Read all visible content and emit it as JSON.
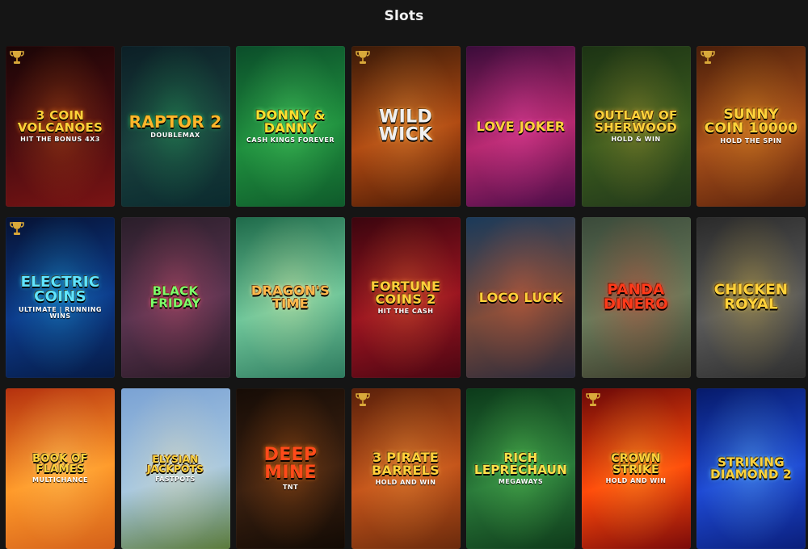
{
  "page": {
    "title": "Slots"
  },
  "games": [
    {
      "logo": "3 COIN VOLCANOES",
      "sub": "HIT the BONUS 4x3",
      "trophy": true,
      "bg": [
        "#1a0506",
        "#4a0c10",
        "#7a1414"
      ],
      "glow": "#ff7a1a",
      "fg": "#ffd23a",
      "size": 15
    },
    {
      "logo": "RAPTOR 2",
      "sub": "DOUBLEMAX",
      "trophy": false,
      "bg": [
        "#0c1f26",
        "#193f3d",
        "#0b2a2e"
      ],
      "glow": "#2ecf6a",
      "fg": "#ffb52a",
      "size": 20
    },
    {
      "logo": "Donny & Danny",
      "sub": "CASH KINGS FOREVER",
      "trophy": false,
      "bg": [
        "#0b4d2a",
        "#1f8f3e",
        "#0f5a2b"
      ],
      "glow": "#6bff7a",
      "fg": "#ffdf2e",
      "size": 16
    },
    {
      "logo": "WILD WICK",
      "sub": "",
      "trophy": true,
      "bg": [
        "#3a1a08",
        "#b04a12",
        "#4a1a06"
      ],
      "glow": "#ffb04a",
      "fg": "#f0f0f0",
      "size": 22
    },
    {
      "logo": "LOVE JOKER",
      "sub": "",
      "trophy": false,
      "bg": [
        "#3a0c3a",
        "#b4286e",
        "#4a0d48"
      ],
      "glow": "#ff4fb4",
      "fg": "#ffd23a",
      "size": 16
    },
    {
      "logo": "OUTLAW OF SHERWOOD",
      "sub": "HOLD & WIN",
      "trophy": false,
      "bg": [
        "#1c3314",
        "#3a5a1e",
        "#22381a"
      ],
      "glow": "#d9b23a",
      "fg": "#ffd23a",
      "size": 15
    },
    {
      "logo": "SUNNY COIN 10000",
      "sub": "HOLD THE SPIN",
      "trophy": true,
      "bg": [
        "#4a1e0a",
        "#a8501a",
        "#5a220c"
      ],
      "glow": "#ffb02a",
      "fg": "#ffd23a",
      "size": 17
    },
    {
      "logo": "ELECTRIC COINS",
      "sub": "ULTIMATE | RUNNING WINS",
      "trophy": true,
      "bg": [
        "#061233",
        "#0c3a8a",
        "#061a44"
      ],
      "glow": "#2ad2ff",
      "fg": "#5fe4ff",
      "size": 18
    },
    {
      "logo": "BLACK FRIDAY",
      "sub": "",
      "trophy": false,
      "bg": [
        "#2a1e2a",
        "#5a3450",
        "#2a1a26"
      ],
      "glow": "#ff5a7a",
      "fg": "#7dff6a",
      "size": 15
    },
    {
      "logo": "DRAGON'S TIME",
      "sub": "",
      "trophy": false,
      "bg": [
        "#1e6a4a",
        "#6fc69a",
        "#2e7a5e"
      ],
      "glow": "#fff1a8",
      "fg": "#ffb84a",
      "size": 16
    },
    {
      "logo": "FORTUNE COINS 2",
      "sub": "HIT THE CASH",
      "trophy": false,
      "bg": [
        "#3a050e",
        "#9a1420",
        "#4a0612"
      ],
      "glow": "#ff8a3a",
      "fg": "#ffcf3a",
      "size": 16
    },
    {
      "logo": "LOCO LUCK",
      "sub": "",
      "trophy": false,
      "bg": [
        "#1a3a5a",
        "#7a4a3a",
        "#2a2a3a"
      ],
      "glow": "#ff6a3a",
      "fg": "#ffd23a",
      "size": 16
    },
    {
      "logo": "PANDA DINERO",
      "sub": "",
      "trophy": false,
      "bg": [
        "#3a4a3a",
        "#6a7a5a",
        "#3a3a2a"
      ],
      "glow": "#ff3a2a",
      "fg": "#ff3a1a",
      "size": 18
    },
    {
      "logo": "CHICKEN ROYAL",
      "sub": "",
      "trophy": false,
      "bg": [
        "#2a2a2a",
        "#5a5a5a",
        "#2e2e2e"
      ],
      "glow": "#ffd23a",
      "fg": "#ffd23a",
      "size": 18
    },
    {
      "logo": "BOOK OF FLAMES",
      "sub": "MULTICHANCE",
      "trophy": false,
      "bg": [
        "#b4300e",
        "#ff9a2a",
        "#d4601a"
      ],
      "glow": "#ffe07a",
      "fg": "#ffd23a",
      "size": 13
    },
    {
      "logo": "ELYSIAN JACKPOTS",
      "sub": "FASTPOTS",
      "trophy": false,
      "bg": [
        "#7aa2d4",
        "#a8c8e0",
        "#5a7a3a"
      ],
      "glow": "#ffe8a8",
      "fg": "#ffd23a",
      "size": 12
    },
    {
      "logo": "DEEP MINE",
      "sub": "TNT",
      "trophy": false,
      "bg": [
        "#160c06",
        "#3a2010",
        "#120a04"
      ],
      "glow": "#ff7a1a",
      "fg": "#ff4a1a",
      "size": 22
    },
    {
      "logo": "3 PIRATE BARRELS",
      "sub": "HOLD AND WIN",
      "trophy": true,
      "bg": [
        "#5a200a",
        "#c4541a",
        "#6a2a0c"
      ],
      "glow": "#ffb04a",
      "fg": "#ffcf3a",
      "size": 16
    },
    {
      "logo": "RICH LEPRECHAUN",
      "sub": "MEGAWAYS",
      "trophy": false,
      "bg": [
        "#0c3a1a",
        "#2a7a3a",
        "#0e3a1a"
      ],
      "glow": "#7aff6a",
      "fg": "#ffe04a",
      "size": 15
    },
    {
      "logo": "CROWN STRIKE",
      "sub": "HOLD AND WIN",
      "trophy": true,
      "bg": [
        "#6a0808",
        "#ff4a0a",
        "#7a0a0a"
      ],
      "glow": "#ffd23a",
      "fg": "#ffd23a",
      "size": 14
    },
    {
      "logo": "STRIKING DIAMOND 2",
      "sub": "",
      "trophy": false,
      "bg": [
        "#061a6a",
        "#1e4ad4",
        "#0a1e7a"
      ],
      "glow": "#7ad8ff",
      "fg": "#ffd23a",
      "size": 15
    }
  ]
}
